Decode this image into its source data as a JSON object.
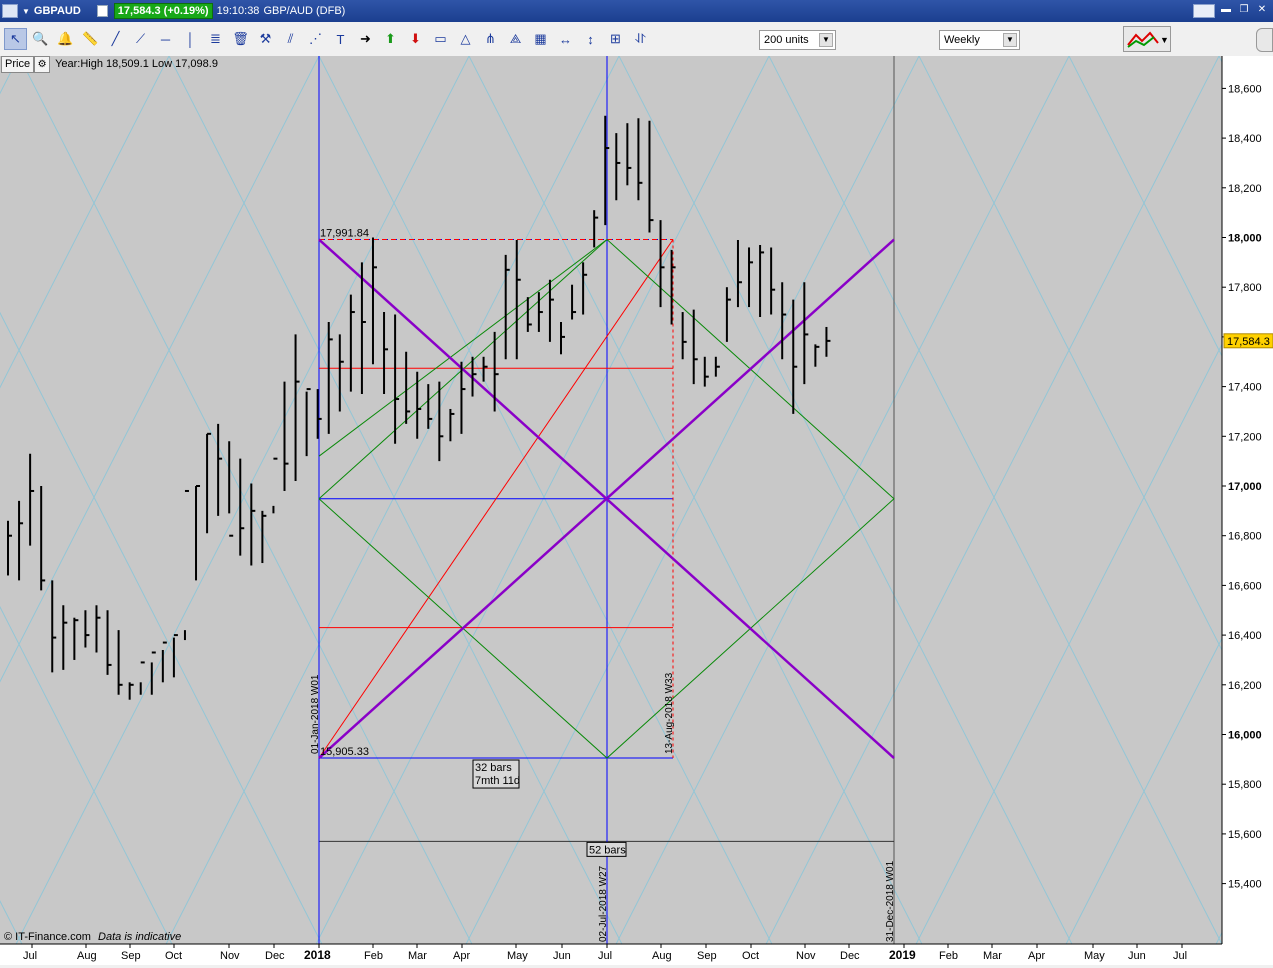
{
  "window": {
    "symbol": "GBPAUD",
    "quote": "17,584.3 (+0.19%)",
    "time": "19:10:38",
    "description": "GBP/AUD (DFB)"
  },
  "toolbar": {
    "tool_icons": [
      "pointer-icon",
      "zoom-icon",
      "alert-icon",
      "ruler-icon",
      "line-icon",
      "ray-icon",
      "horizontal-line-icon",
      "vertical-line-icon",
      "fibonacci-icon",
      "delete-icon",
      "hammer-icon",
      "parallel-channel-icon",
      "trend-channel-icon",
      "text-icon",
      "arrow-icon",
      "buy-arrow-icon",
      "sell-arrow-icon",
      "rectangle-icon",
      "triangle-icon",
      "pitchfork-icon",
      "gann-fan-icon",
      "gann-grid-icon",
      "measure-icon",
      "time-span-icon",
      "gann-square-icon",
      "cycle-icon"
    ],
    "units_select": "200 units",
    "interval_select": "Weekly"
  },
  "price_panel": {
    "tab_label": "Price",
    "year_range": "Year:High 18,509.1 Low 17,098.9"
  },
  "footer": {
    "copyright": "© IT-Finance.com",
    "notice": "Data is indicative"
  },
  "chart_data": {
    "type": "bar",
    "title": "",
    "xlabel": "",
    "ylabel": "",
    "x_tick_labels": [
      "Jul",
      "Aug",
      "Sep",
      "Oct",
      "Nov",
      "Dec",
      "2018",
      "Feb",
      "Mar",
      "Apr",
      "May",
      "Jun",
      "Jul",
      "Aug",
      "Sep",
      "Oct",
      "Nov",
      "Dec",
      "2019",
      "Feb",
      "Mar",
      "Apr",
      "May",
      "Jun",
      "Jul"
    ],
    "y_ticks": [
      15400,
      15600,
      15800,
      16000,
      16200,
      16400,
      16600,
      16800,
      17000,
      17200,
      17400,
      17600,
      17800,
      18000,
      18200,
      18400,
      18600
    ],
    "y_tick_labels": [
      "15,400",
      "15,600",
      "15,800",
      "16,000",
      "16,200",
      "16,400",
      "16,600",
      "16,800",
      "17,000",
      "17,200",
      "17,400",
      "17,600",
      "17,800",
      "18,000",
      "18,200",
      "18,400",
      "18,600"
    ],
    "y_major_ticks": [
      16000,
      17000,
      18000
    ],
    "ylim": [
      15160,
      18720
    ],
    "last_price_label": "17,584.3",
    "last_price": 17584.3,
    "grid": "diagonal",
    "ohlc_weeks_from_first_visible_bar": {
      "high": [
        16860,
        16940,
        17130,
        17000,
        16620,
        16520,
        16470,
        16500,
        16520,
        16500,
        16420,
        16210,
        16210,
        16290,
        16340,
        16390,
        16420,
        17000,
        17210,
        17250,
        17180,
        17110,
        17010,
        16900,
        16890,
        17420,
        17610,
        17380,
        17390,
        17660,
        17610,
        17770,
        17900,
        18000,
        17700,
        17690,
        17540,
        17460,
        17410,
        17420,
        17310,
        17500,
        17520,
        17520,
        17620,
        17930,
        17990,
        17760,
        17780,
        17830,
        17660,
        17810,
        17900,
        18110,
        18490,
        18420,
        18460,
        18480,
        18470,
        18070,
        17950,
        17700,
        17710,
        17520,
        17520,
        17800,
        17990,
        17960,
        17970,
        17960,
        17820,
        17750,
        17820,
        17570,
        17640
      ],
      "low": [
        16640,
        16620,
        16760,
        16580,
        16250,
        16260,
        16300,
        16350,
        16330,
        16240,
        16160,
        16140,
        16160,
        16160,
        16210,
        16230,
        16380,
        16620,
        16810,
        16880,
        16890,
        16720,
        16680,
        16690,
        16920,
        16980,
        17020,
        17120,
        17190,
        17210,
        17300,
        17380,
        17370,
        17490,
        17370,
        17170,
        17250,
        17190,
        17230,
        17100,
        17180,
        17210,
        17360,
        17420,
        17300,
        17510,
        17510,
        17620,
        17620,
        17580,
        17530,
        17670,
        17690,
        17960,
        18050,
        18150,
        18210,
        18150,
        18020,
        17720,
        17650,
        17510,
        17410,
        17400,
        17440,
        17580,
        17720,
        17720,
        17680,
        17690,
        17510,
        17290,
        17410,
        17480,
        17520
      ],
      "close": [
        16800,
        16850,
        16980,
        16620,
        16390,
        16450,
        16460,
        16400,
        16470,
        16280,
        16200,
        16200,
        16290,
        16330,
        16370,
        16400,
        16980,
        17000,
        17210,
        17110,
        16800,
        16830,
        16900,
        16880,
        17110,
        17090,
        17420,
        17390,
        17270,
        17590,
        17500,
        17700,
        17660,
        17880,
        17550,
        17350,
        17300,
        17310,
        17270,
        17200,
        17290,
        17390,
        17450,
        17480,
        17450,
        17870,
        17830,
        17650,
        17700,
        17750,
        17600,
        17700,
        17850,
        18080,
        18360,
        18300,
        18280,
        18220,
        18070,
        17880,
        17880,
        17580,
        17510,
        17440,
        17480,
        17750,
        17820,
        17900,
        17940,
        17790,
        17690,
        17480,
        17610,
        17560,
        17584
      ]
    },
    "annotations": [
      {
        "label": "17,991.84",
        "value": 17991.84
      },
      {
        "label": "15,905.33",
        "value": 15905.33
      },
      {
        "label": "32 bars"
      },
      {
        "label": "7mth 11d"
      },
      {
        "label": "52 bars"
      },
      {
        "label": "01-Jan-2018 W01"
      },
      {
        "label": "02-Jul-2018 W27"
      },
      {
        "label": "13-Aug-2018 W33"
      },
      {
        "label": "31-Dec-2018 W01"
      }
    ],
    "colors": {
      "background": "#c8c8c8",
      "bars": "#000000",
      "grid": "#8ec6d8",
      "frame": "#0000ff",
      "red_lines": "#ff0000",
      "green_lines": "#0a8a0a",
      "purple_lines": "#8a00c8",
      "price_marker": "#ffd100"
    }
  }
}
